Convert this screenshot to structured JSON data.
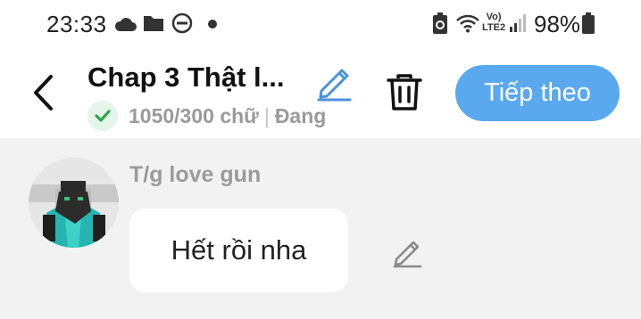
{
  "status_bar": {
    "time": "23:33",
    "battery_percent": "98%",
    "network_label_top": "Vo)",
    "network_label_bottom": "LTE2",
    "icons": [
      "cloud-icon",
      "folder-icon",
      "dnd-icon",
      "dot-icon",
      "battery-saver-icon",
      "wifi-icon",
      "signal-icon",
      "battery-icon"
    ]
  },
  "header": {
    "title": "Chap 3 Thật l...",
    "word_count": "1050/300 chữ",
    "status_text": "Đang",
    "next_button_label": "Tiếp theo"
  },
  "message": {
    "author": "T/g love gun",
    "text": "Hết rồi nha"
  },
  "colors": {
    "accent": "#5aa8ee",
    "check_green": "#2ea84c",
    "muted_text": "#9a9a9a",
    "chat_bg": "#f2f2f2"
  }
}
